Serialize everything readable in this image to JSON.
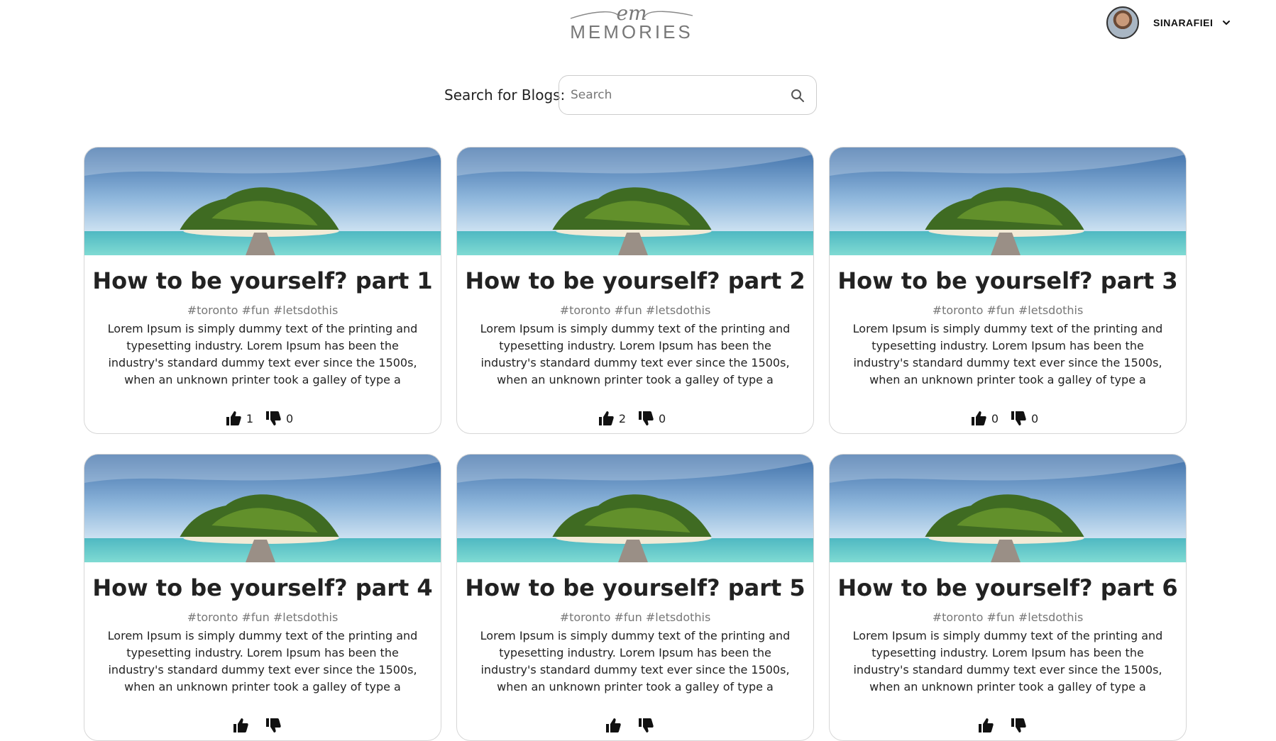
{
  "header": {
    "logo_mark": "em",
    "logo_word": "MEMORIES",
    "username": "SINARAFIEI"
  },
  "search": {
    "label": "Search for Blogs:",
    "placeholder": "Search",
    "value": ""
  },
  "posts": [
    {
      "title": "How to be yourself? part 1",
      "tags": "#toronto #fun #letsdothis",
      "body": "Lorem Ipsum is simply dummy text of the printing and typesetting industry. Lorem Ipsum has been the industry's standard dummy text ever since the 1500s, when an unknown printer took a galley of type a",
      "likes": "1",
      "dislikes": "0"
    },
    {
      "title": "How to be yourself? part 2",
      "tags": "#toronto #fun #letsdothis",
      "body": "Lorem Ipsum is simply dummy text of the printing and typesetting industry. Lorem Ipsum has been the industry's standard dummy text ever since the 1500s, when an unknown printer took a galley of type a",
      "likes": "2",
      "dislikes": "0"
    },
    {
      "title": "How to be yourself? part 3",
      "tags": "#toronto #fun #letsdothis",
      "body": "Lorem Ipsum is simply dummy text of the printing and typesetting industry. Lorem Ipsum has been the industry's standard dummy text ever since the 1500s, when an unknown printer took a galley of type a",
      "likes": "0",
      "dislikes": "0"
    },
    {
      "title": "How to be yourself? part 4",
      "tags": "#toronto #fun #letsdothis",
      "body": "Lorem Ipsum is simply dummy text of the printing and typesetting industry. Lorem Ipsum has been the industry's standard dummy text ever since the 1500s, when an unknown printer took a galley of type a",
      "likes": "",
      "dislikes": ""
    },
    {
      "title": "How to be yourself? part 5",
      "tags": "#toronto #fun #letsdothis",
      "body": "Lorem Ipsum is simply dummy text of the printing and typesetting industry. Lorem Ipsum has been the industry's standard dummy text ever since the 1500s, when an unknown printer took a galley of type a",
      "likes": "",
      "dislikes": ""
    },
    {
      "title": "How to be yourself? part 6",
      "tags": "#toronto #fun #letsdothis",
      "body": "Lorem Ipsum is simply dummy text of the printing and typesetting industry. Lorem Ipsum has been the industry's standard dummy text ever since the 1500s, when an unknown printer took a galley of type a",
      "likes": "",
      "dislikes": ""
    }
  ],
  "colors": {
    "card_border": "#d6d6d6",
    "tag_text": "#777777",
    "logo": "#777777"
  },
  "icons": [
    "logo",
    "avatar",
    "chevron-down-icon",
    "search-icon",
    "thumbs-up-icon",
    "thumbs-down-icon"
  ]
}
